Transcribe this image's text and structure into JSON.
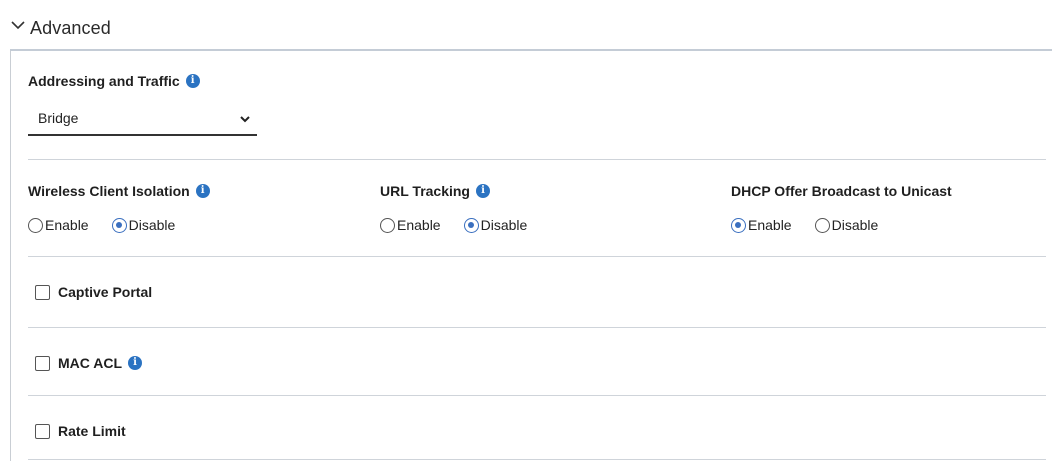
{
  "section": {
    "title": "Advanced"
  },
  "addressing": {
    "label": "Addressing and Traffic",
    "selected": "Bridge"
  },
  "wireless_client_isolation": {
    "label": "Wireless Client Isolation",
    "options": [
      "Enable",
      "Disable"
    ],
    "selected": "Disable"
  },
  "url_tracking": {
    "label": "URL Tracking",
    "options": [
      "Enable",
      "Disable"
    ],
    "selected": "Disable"
  },
  "dhcp_offer": {
    "label": "DHCP Offer Broadcast to Unicast",
    "options": [
      "Enable",
      "Disable"
    ],
    "selected": "Enable"
  },
  "captive_portal": {
    "label": "Captive Portal",
    "checked": false
  },
  "mac_acl": {
    "label": "MAC ACL",
    "checked": false
  },
  "rate_limit": {
    "label": "Rate Limit",
    "checked": false
  },
  "colors": {
    "accent": "#3a6fbf",
    "info_icon": "#2b73c2",
    "divider": "#cfd4da"
  },
  "icons": {
    "collapse": "chevron-down-icon",
    "info": "info-icon",
    "select_caret": "caret-down-icon"
  }
}
